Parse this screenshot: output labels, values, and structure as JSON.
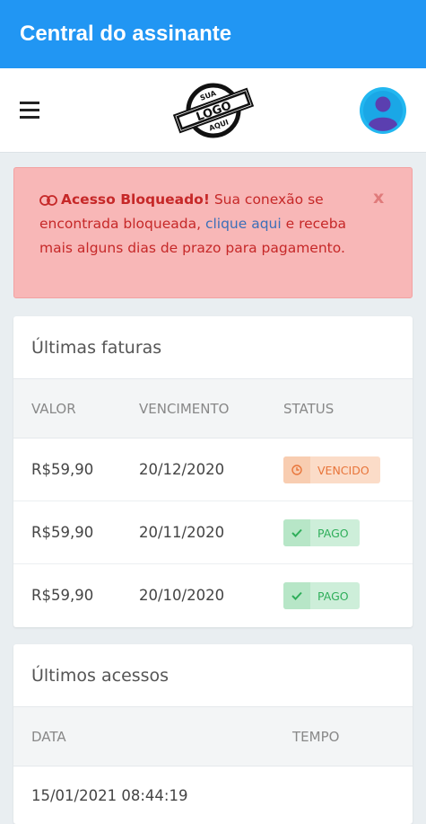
{
  "appbar": {
    "title": "Central do assinante"
  },
  "header": {
    "logo": {
      "top": "SUA",
      "middle": "LOGO",
      "bottom": "AQUI"
    }
  },
  "alert": {
    "title": "Acesso Bloqueado!",
    "text_before": "Sua conexão se encontrada bloqueada,",
    "link": "clique aqui",
    "text_after": "e receba mais alguns dias de prazo para pagamento.",
    "close": "x"
  },
  "faturas": {
    "title": "Últimas faturas",
    "columns": {
      "valor": "VALOR",
      "vencimento": "VENCIMENTO",
      "status": "STATUS"
    },
    "rows": [
      {
        "valor": "R$59,90",
        "vencimento": "20/12/2020",
        "status": "VENCIDO"
      },
      {
        "valor": "R$59,90",
        "vencimento": "20/11/2020",
        "status": "PAGO"
      },
      {
        "valor": "R$59,90",
        "vencimento": "20/10/2020",
        "status": "PAGO"
      }
    ]
  },
  "acessos": {
    "title": "Últimos acessos",
    "columns": {
      "data": "DATA",
      "tempo": "TEMPO"
    },
    "rows": [
      {
        "data": "15/01/2021 08:44:19",
        "tempo": ""
      }
    ]
  },
  "colors": {
    "primary": "#2196f3",
    "alert_bg": "#f8b7b7",
    "alert_text": "#c62828",
    "vencido": "#e8753a",
    "pago": "#2fae5a"
  }
}
